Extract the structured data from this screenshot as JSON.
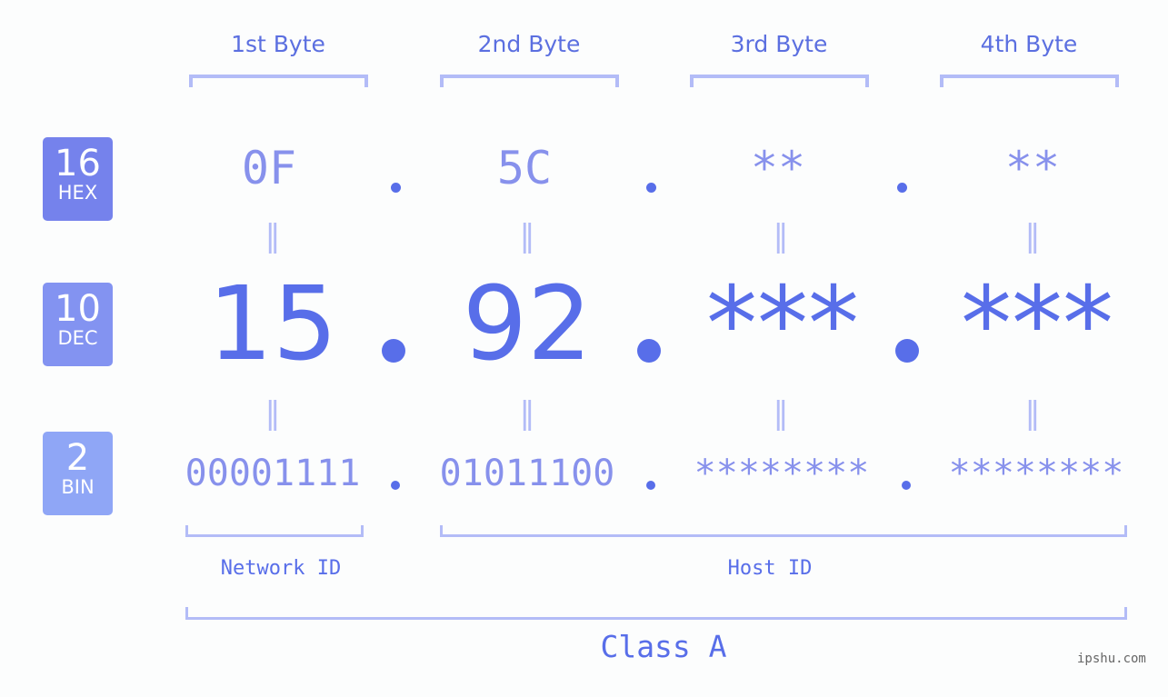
{
  "badges": [
    {
      "num": "16",
      "label": "HEX",
      "color": "#7582ec"
    },
    {
      "num": "10",
      "label": "DEC",
      "color": "#8393f1"
    },
    {
      "num": "2",
      "label": "BIN",
      "color": "#8fa6f6"
    }
  ],
  "bytes": [
    {
      "header": "1st Byte",
      "hex": "0F",
      "dec": "15",
      "bin": "00001111"
    },
    {
      "header": "2nd Byte",
      "hex": "5C",
      "dec": "92",
      "bin": "01011100"
    },
    {
      "header": "3rd Byte",
      "hex": "**",
      "dec": "***",
      "bin": "********"
    },
    {
      "header": "4th Byte",
      "hex": "**",
      "dec": "***",
      "bin": "********"
    }
  ],
  "equals_symbol": "=",
  "network_label": "Network ID",
  "host_label": "Host ID",
  "class_label": "Class A",
  "watermark": "ipshu.com",
  "colors": {
    "accent": "#586ee9",
    "light": "#8791ec",
    "bracket": "#b3bcf7"
  }
}
